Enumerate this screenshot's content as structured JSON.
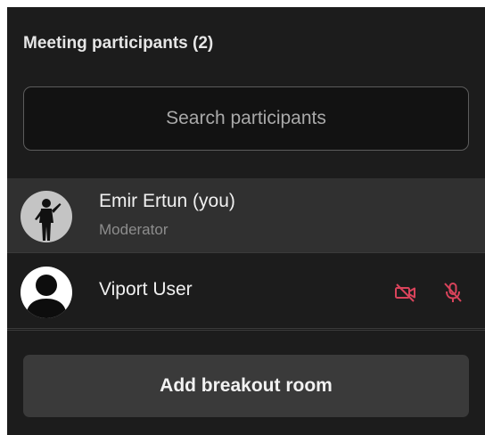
{
  "panel": {
    "title": "Meeting participants (2)"
  },
  "search": {
    "placeholder": "Search participants",
    "value": ""
  },
  "participants": [
    {
      "name": "Emir Ertun (you)",
      "role": "Moderator",
      "avatar_icon": "user-avatar-photo",
      "highlighted": true
    },
    {
      "name": "Viport User",
      "role": "",
      "avatar_icon": "default-avatar-icon",
      "camera_muted": true,
      "mic_muted": true,
      "status_icons": [
        "camera-off-icon",
        "microphone-off-icon"
      ]
    }
  ],
  "actions": {
    "add_breakout_label": "Add breakout room"
  },
  "colors": {
    "panel_bg": "#1c1c1c",
    "row_highlight": "#303030",
    "muted_icon": "#d9435b",
    "button_bg": "#3a3a3a",
    "text": "#f0f0f0",
    "secondary_text": "#8d8d8d"
  }
}
